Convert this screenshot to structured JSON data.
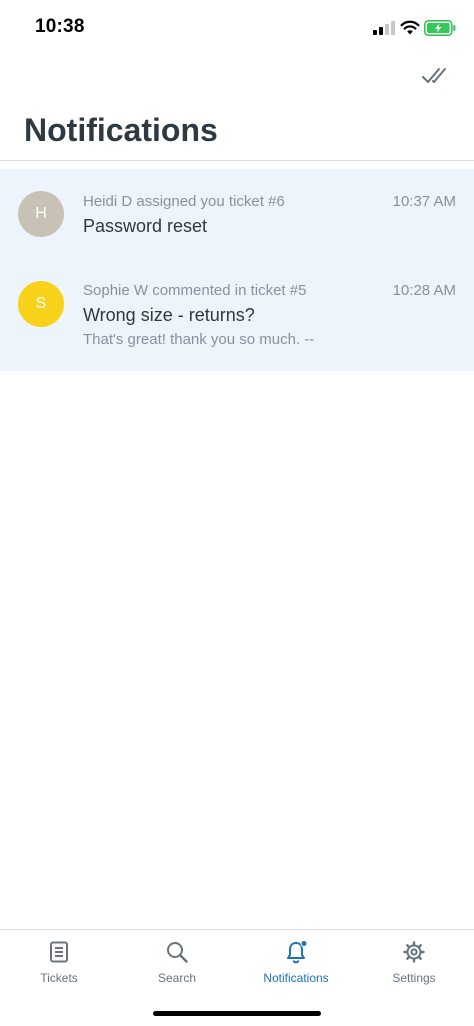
{
  "status_bar": {
    "time": "10:38"
  },
  "header": {
    "title": "Notifications",
    "mark_all_read_icon": "double-check-icon"
  },
  "notifications": [
    {
      "avatar_initial": "H",
      "avatar_color": "#c8c1b6",
      "meta": "Heidi D assigned you ticket #6",
      "time": "10:37 AM",
      "subject": "Password reset",
      "preview": ""
    },
    {
      "avatar_initial": "S",
      "avatar_color": "#f7d11a",
      "meta": "Sophie W commented in ticket #5",
      "time": "10:28 AM",
      "subject": "Wrong size - returns?",
      "preview": "That's great! thank you so much. --"
    }
  ],
  "tabs": [
    {
      "label": "Tickets",
      "icon": "tickets-icon",
      "active": false
    },
    {
      "label": "Search",
      "icon": "search-icon",
      "active": false
    },
    {
      "label": "Notifications",
      "icon": "bell-icon",
      "active": true,
      "badge": true
    },
    {
      "label": "Settings",
      "icon": "gear-icon",
      "active": false
    }
  ],
  "colors": {
    "accent": "#1f73b7",
    "unread_background": "#edf4fc",
    "text_primary": "#2f3941",
    "text_secondary": "#87929d"
  }
}
